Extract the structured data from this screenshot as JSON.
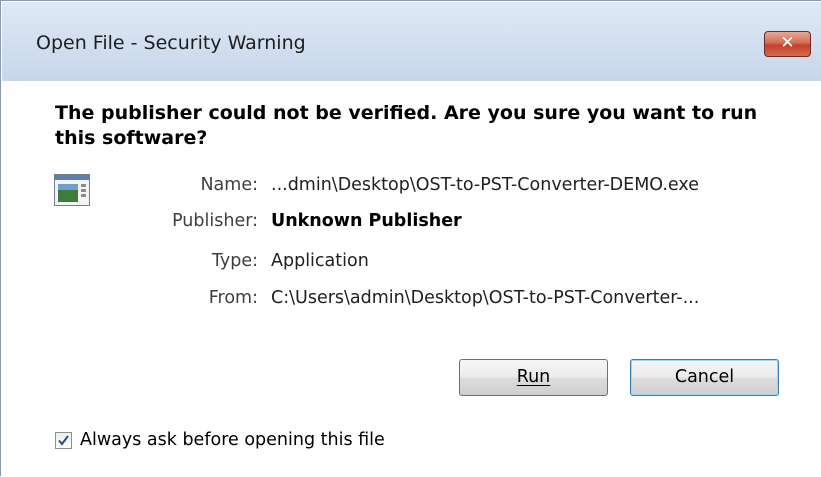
{
  "window": {
    "title": "Open File - Security Warning",
    "close_label": "✕"
  },
  "message": {
    "heading": "The publisher could not be verified.  Are you sure you want to run this software?"
  },
  "file_icon": "application-window-icon",
  "details": {
    "name_label": "Name:",
    "name_value": "...dmin\\Desktop\\OST-to-PST-Converter-DEMO.exe",
    "publisher_label": "Publisher:",
    "publisher_value": "Unknown Publisher",
    "type_label": "Type:",
    "type_value": "Application",
    "from_label": "From:",
    "from_value": "C:\\Users\\admin\\Desktop\\OST-to-PST-Converter-..."
  },
  "buttons": {
    "run_label": "Run",
    "cancel_label": "Cancel"
  },
  "footer": {
    "checkbox_label": "Always ask before opening this file",
    "checkbox_checked": true
  }
}
